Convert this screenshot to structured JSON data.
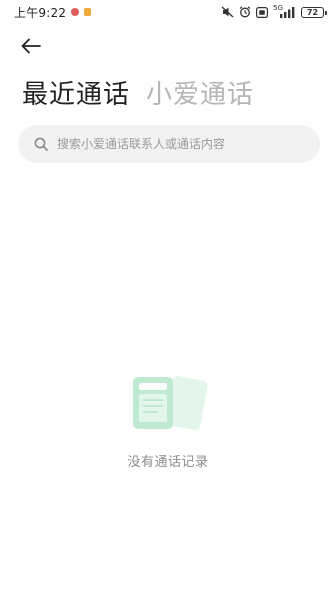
{
  "status_bar": {
    "time": "上午9:22",
    "network": "5G",
    "battery": "72"
  },
  "icons": {
    "back": "arrow-left-icon",
    "search": "search-icon",
    "empty": "call-log-empty-icon"
  },
  "tabs": [
    {
      "label": "最近通话",
      "active": true
    },
    {
      "label": "小爱通话",
      "active": false
    }
  ],
  "search": {
    "placeholder": "搜索小爱通话联系人或通话内容",
    "value": ""
  },
  "empty_state": {
    "message": "没有通话记录"
  },
  "colors": {
    "accent_green": "#7fd6a4",
    "tab_inactive": "#b5b5b5",
    "search_bg": "#f2f2f2"
  }
}
